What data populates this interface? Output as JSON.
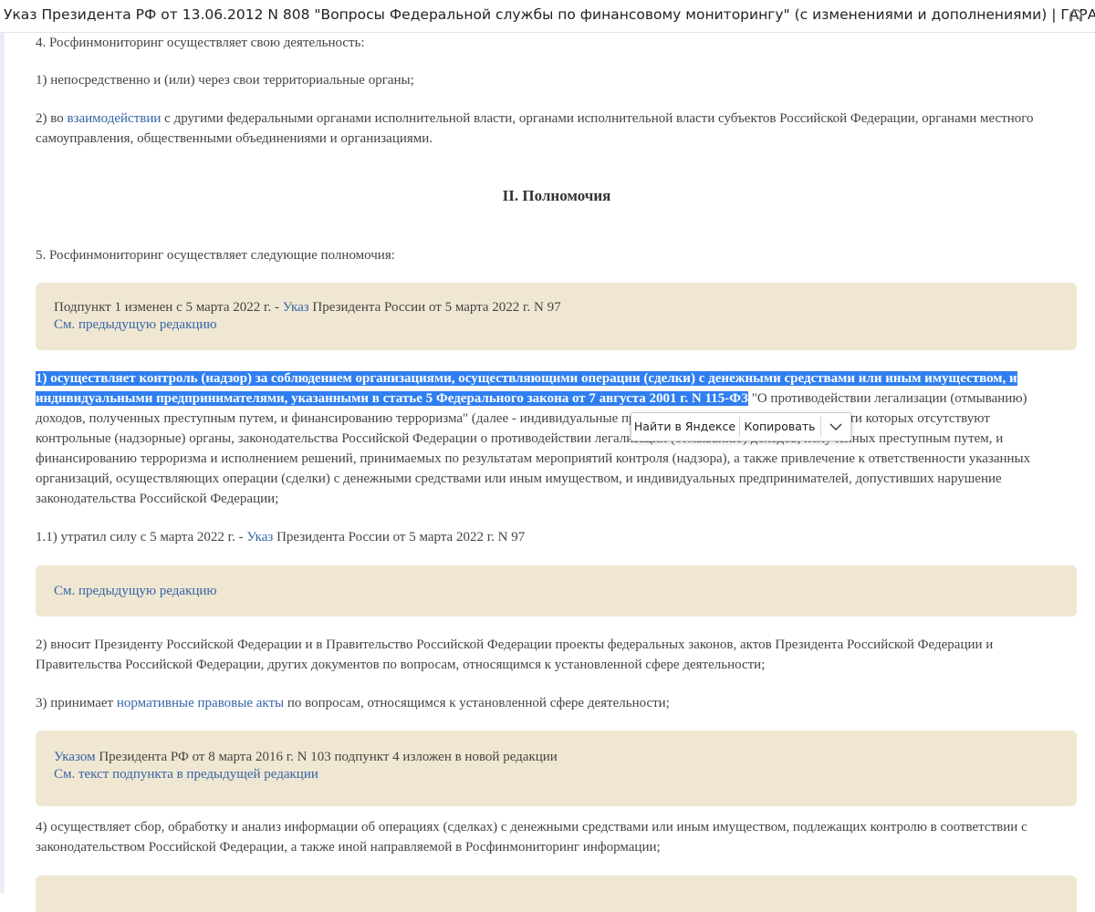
{
  "window": {
    "title": "Указ Президента РФ от 13.06.2012 N 808 \"Вопросы Федеральной службы по финансовому мониторингу\" (с изменениями и дополнениями) | ГАРАНТ",
    "icon": "headphones-icon"
  },
  "doc": {
    "p4": "4. Росфинмониторинг осуществляет свою деятельность:",
    "p4_1": "1) непосредственно и (или) через свои территориальные органы;",
    "p4_2_a": "2) во ",
    "p4_2_link": "взаимодействии",
    "p4_2_b": " с другими федеральными органами исполнительной власти, органами исполнительной власти субъектов Российской Федерации, органами местного самоуправления, общественными объединениями и организациями.",
    "section_heading": "II. Полномочия",
    "p5": "5. Росфинмониторинг осуществляет следующие полномочия:",
    "note1_a": "Подпункт 1 изменен с 5 марта 2022 г. - ",
    "note1_link": "Указ",
    "note1_b": " Президента России от 5 марта 2022 г. N 97",
    "note1_prev": "См. предыдущую редакцию",
    "p5_1_selected": "1) осуществляет контроль (надзор) за соблюдением организациями, осуществляющими операции (сделки) с денежными средствами или иным имуществом, и индивидуальными предпринимателями, указанными в статье 5 Федерального закона от 7 августа 2001 г. N 115-ФЗ",
    "p5_1_rest": " \"О противодействии легализации (отмыванию) доходов, полученных преступным путем, и финансированию терроризма\" (далее - индивидуальные предприниматели), в сфере деятельности которых отсутствуют контрольные (надзорные) органы, законодательства Российской Федерации о противодействии легализации (отмыванию) доходов, полученных преступным путем, и финансированию терроризма и исполнением решений, принимаемых по результатам мероприятий контроля (надзора), а также привлечение к ответственности указанных организаций, осуществляющих операции (сделки) с денежными средствами или иным имуществом, и индивидуальных предпринимателей, допустивших нарушение законодательства Российской Федерации;",
    "p5_1_1_a": "1.1) утратил силу с 5 марта 2022 г. - ",
    "p5_1_1_link": "Указ",
    "p5_1_1_b": " Президента России от 5 марта 2022 г. N 97",
    "note2_prev": "См. предыдущую редакцию",
    "p5_2": "2) вносит Президенту Российской Федерации и в Правительство Российской Федерации проекты федеральных законов, актов Президента Российской Федерации и Правительства Российской Федерации, других документов по вопросам, относящимся к установленной сфере деятельности;",
    "p5_3_a": "3) принимает ",
    "p5_3_link": "нормативные правовые акты",
    "p5_3_b": " по вопросам, относящимся к установленной сфере деятельности;",
    "note3_link": "Указом",
    "note3_b": " Президента РФ от 8 марта 2016 г. N 103 подпункт 4 изложен в новой редакции",
    "note3_prev": "См. текст подпункта в предыдущей редакции",
    "p5_4": "4) осуществляет сбор, обработку и анализ информации об операциях (сделках) с денежными средствами или иным имуществом, подлежащих контролю в соответствии с законодательством Российской Федерации, а также иной направляемой в Росфинмониторинг информации;"
  },
  "selection_popup": {
    "search_label": "Найти в Яндексе",
    "copy_label": "Копировать",
    "more_icon": "chevron-down-icon"
  },
  "colors": {
    "link": "#3565a8",
    "note_bg": "#f0e7d2",
    "selection": "#2f7ff0"
  }
}
